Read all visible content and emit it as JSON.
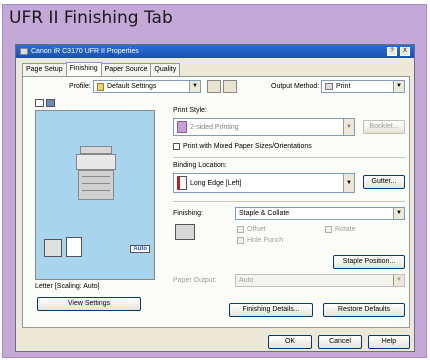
{
  "caption": "UFR II Finishing Tab",
  "window": {
    "title": "Canon iR C3170 UFR II Properties",
    "help_btn": "?",
    "close_btn": "X"
  },
  "tabs": [
    {
      "label": "Page Setup"
    },
    {
      "label": "Finishing"
    },
    {
      "label": "Paper Source"
    },
    {
      "label": "Quality"
    }
  ],
  "profile": {
    "label": "Profile:",
    "value": "Default Settings"
  },
  "output_method": {
    "label": "Output Method:",
    "value": "Print"
  },
  "print_style": {
    "label": "Print Style:",
    "value": "2-sided Printing",
    "booklet_btn": "Booklet..."
  },
  "mixed_sizes": {
    "label": "Print with Mixed Paper Sizes/Orientations"
  },
  "binding": {
    "label": "Binding Location:",
    "value": "Long Edge [Left]",
    "gutter_btn": "Gutter..."
  },
  "finishing": {
    "label": "Finishing:",
    "value": "Staple & Collate",
    "offset": "Offset",
    "rotate": "Rotate",
    "hole_punch": "Hole Punch",
    "staple_pos_btn": "Staple Position..."
  },
  "paper_output": {
    "label": "Paper Output:",
    "value": "Auto"
  },
  "preview": {
    "auto_badge": "Auto",
    "status": "Letter [Scaling: Auto]",
    "view_btn": "View Settings"
  },
  "bottom": {
    "details_btn": "Finishing Details...",
    "restore_btn": "Restore Defaults"
  },
  "footer": {
    "ok": "OK",
    "cancel": "Cancel",
    "help": "Help"
  },
  "colors": {
    "frame": "#c4a8d8",
    "titlebar": "#1b4fb0",
    "preview": "#a8d4ee",
    "dialog": "#ece9d8"
  }
}
